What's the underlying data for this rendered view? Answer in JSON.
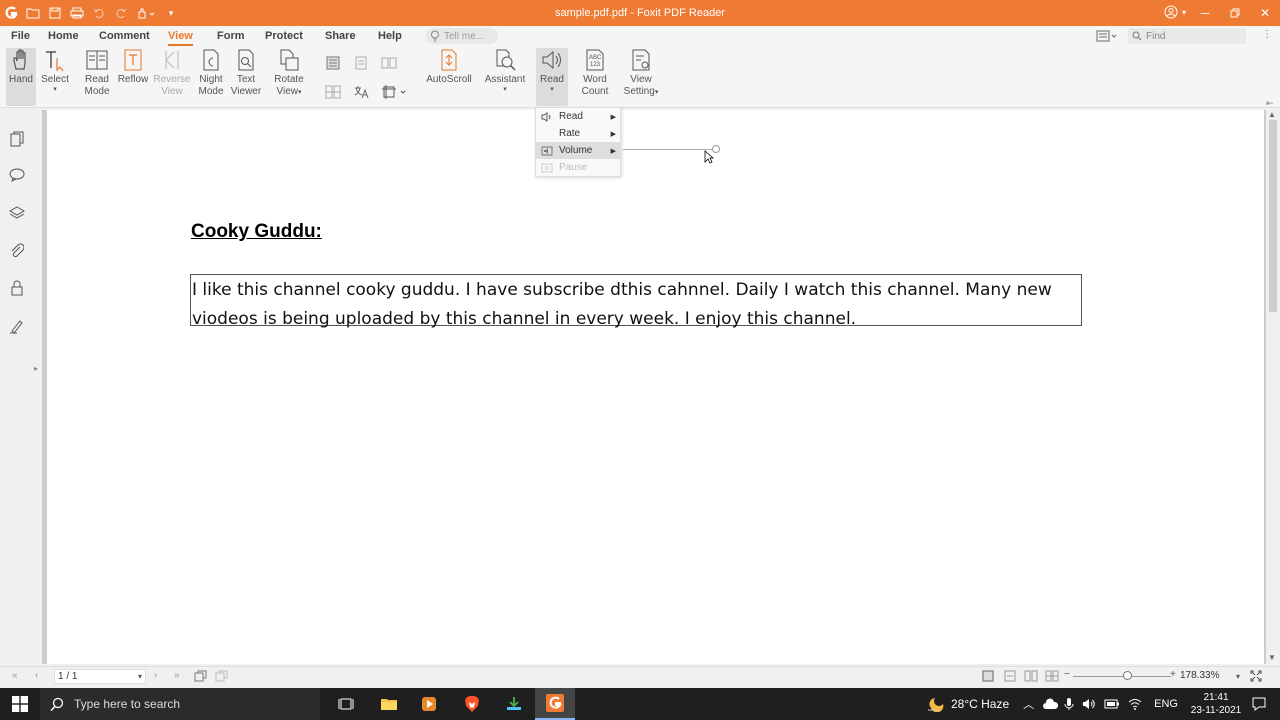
{
  "window": {
    "title": "sample.pdf.pdf - Foxit PDF Reader"
  },
  "menu": {
    "tabs": [
      "File",
      "Home",
      "Comment",
      "View",
      "Form",
      "Protect",
      "Share",
      "Help"
    ],
    "active_tab": "View",
    "tell_me_placeholder": "Tell me...",
    "find_placeholder": "Find"
  },
  "ribbon": {
    "hand": "Hand",
    "select": "Select",
    "read_mode_1": "Read",
    "read_mode_2": "Mode",
    "reflow": "Reflow",
    "reverse_view_1": "Reverse",
    "reverse_view_2": "View",
    "night_mode_1": "Night",
    "night_mode_2": "Mode",
    "text_viewer_1": "Text",
    "text_viewer_2": "Viewer",
    "rotate_view_1": "Rotate",
    "rotate_view_2": "View",
    "autoscroll": "AutoScroll",
    "assistant": "Assistant",
    "read": "Read",
    "word_count_1": "Word",
    "word_count_2": "Count",
    "view_setting_1": "View",
    "view_setting_2": "Setting"
  },
  "read_menu": {
    "items": [
      {
        "label": "Read",
        "has_submenu": true,
        "state": "normal"
      },
      {
        "label": "Rate",
        "has_submenu": true,
        "state": "normal"
      },
      {
        "label": "Volume",
        "has_submenu": true,
        "state": "hover"
      },
      {
        "label": "Pause",
        "has_submenu": false,
        "state": "disabled"
      }
    ],
    "volume_level": 0.97
  },
  "document": {
    "heading": "Cooky Guddu:",
    "body_line_1": "I like this channel cooky guddu. I have subscribe dthis cahnnel.  Daily I watch this channel. Many new",
    "body_line_2": "viodeos is being uploaded by this channel in every week. I enjoy this channel."
  },
  "statusbar": {
    "page_field": "1 / 1",
    "zoom": "178.33%",
    "zoom_level": 0.55
  },
  "taskbar": {
    "search_placeholder": "Type here to search",
    "weather": "28°C  Haze",
    "language": "ENG",
    "time": "21:41",
    "date": "23-11-2021"
  },
  "colors": {
    "brand_orange": "#ee7a33",
    "active_tab": "#e8792b",
    "taskbar": "#1f1f1f"
  }
}
